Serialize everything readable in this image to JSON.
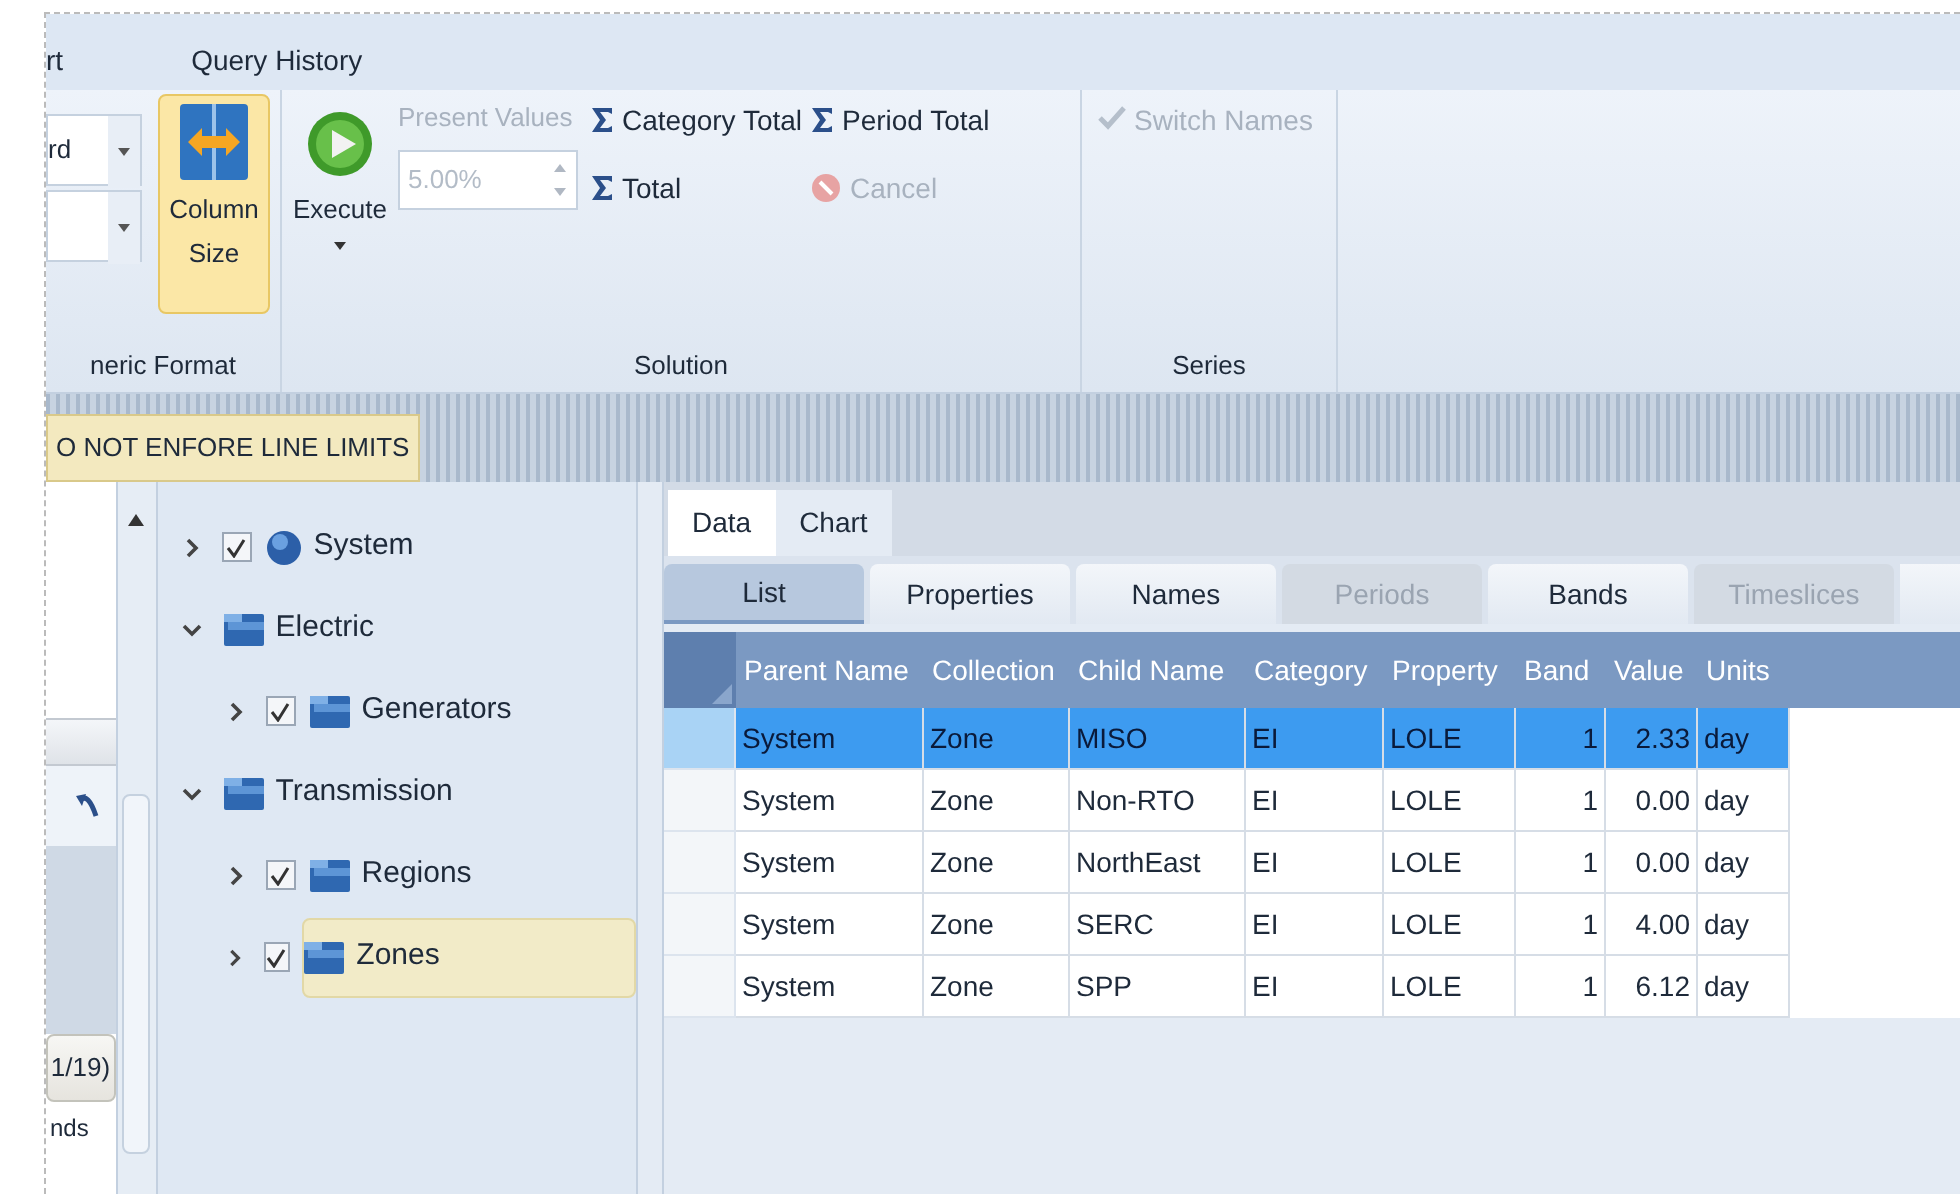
{
  "menu": [
    {
      "label": "rt"
    },
    {
      "label": "Query History"
    }
  ],
  "ribbon": {
    "numeric_format": {
      "dropdown_value": "rd",
      "column_size": {
        "label": "Column Size",
        "on": true
      },
      "group_label": "neric Format"
    },
    "solution": {
      "execute": {
        "label": "Execute"
      },
      "present_values": {
        "label": "Present Values",
        "disabled": true,
        "value": "5.00%"
      },
      "sums": [
        {
          "label": "Category Total",
          "disabled": false
        },
        {
          "label": "Period Total",
          "disabled": false
        },
        {
          "label": "Total",
          "disabled": false
        }
      ],
      "cancel": {
        "label": "Cancel",
        "disabled": true
      },
      "group_label": "Solution"
    },
    "series": {
      "switch_names": {
        "label": "Switch Names",
        "disabled": true
      },
      "group_label": "Series"
    }
  },
  "banner": {
    "label": "O NOT ENFORE LINE LIMITS"
  },
  "left_panel": {
    "counter": "1/19)",
    "footer": "nds"
  },
  "tree": [
    {
      "label": "System",
      "kind": "globe",
      "checked": true,
      "expanded": false,
      "selected": false
    },
    {
      "label": "Electric",
      "kind": "folder",
      "expanded": true,
      "selected": false,
      "children": [
        {
          "label": "Generators",
          "kind": "folder",
          "checked": true,
          "expanded": false,
          "selected": false
        }
      ]
    },
    {
      "label": "Transmission",
      "kind": "folder",
      "expanded": true,
      "selected": false,
      "children": [
        {
          "label": "Regions",
          "kind": "folder",
          "checked": true,
          "expanded": false,
          "selected": false
        },
        {
          "label": "Zones",
          "kind": "folder",
          "checked": true,
          "expanded": false,
          "selected": true
        }
      ]
    }
  ],
  "tabs": [
    {
      "label": "Data",
      "selected": true
    },
    {
      "label": "Chart",
      "selected": false
    }
  ],
  "subtabs": [
    {
      "label": "List",
      "selected": true,
      "disabled": false
    },
    {
      "label": "Properties",
      "selected": false,
      "disabled": false
    },
    {
      "label": "Names",
      "selected": false,
      "disabled": false
    },
    {
      "label": "Periods",
      "selected": false,
      "disabled": true
    },
    {
      "label": "Bands",
      "selected": false,
      "disabled": false
    },
    {
      "label": "Timeslices",
      "selected": false,
      "disabled": true
    }
  ],
  "table": {
    "columns": [
      "Parent Name",
      "Collection",
      "Child Name",
      "Category",
      "Property",
      "Band",
      "Value",
      "Units"
    ],
    "rows": [
      {
        "cells": [
          "System",
          "Zone",
          "MISO",
          "EI",
          "LOLE",
          "1",
          "2.33",
          "day"
        ],
        "selected": true
      },
      {
        "cells": [
          "System",
          "Zone",
          "Non-RTO",
          "EI",
          "LOLE",
          "1",
          "0.00",
          "day"
        ],
        "selected": false
      },
      {
        "cells": [
          "System",
          "Zone",
          "NorthEast",
          "EI",
          "LOLE",
          "1",
          "0.00",
          "day"
        ],
        "selected": false
      },
      {
        "cells": [
          "System",
          "Zone",
          "SERC",
          "EI",
          "LOLE",
          "1",
          "4.00",
          "day"
        ],
        "selected": false
      },
      {
        "cells": [
          "System",
          "Zone",
          "SPP",
          "EI",
          "LOLE",
          "1",
          "6.12",
          "day"
        ],
        "selected": false
      }
    ]
  }
}
